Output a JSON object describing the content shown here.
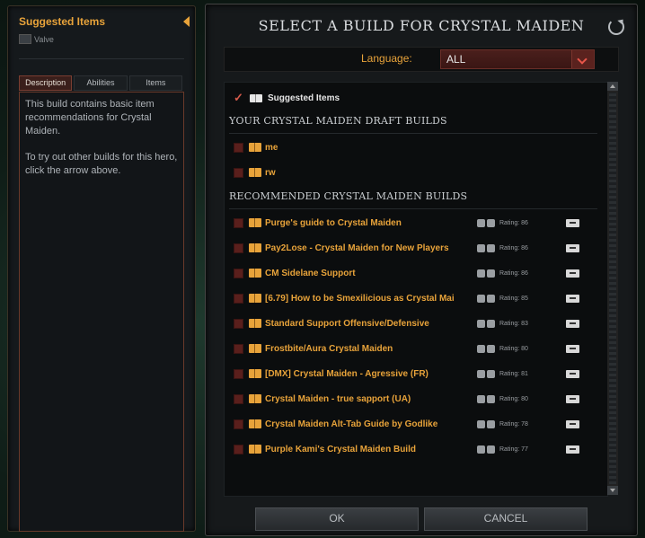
{
  "left_panel": {
    "title": "Suggested Items",
    "author": "Valve",
    "tabs": [
      "Description",
      "Abilities",
      "Items"
    ],
    "description": [
      "This build contains basic item recommendations for Crystal Maiden.",
      "To try out other builds for this hero, click the arrow above."
    ]
  },
  "dialog": {
    "title": "SELECT A BUILD FOR CRYSTAL MAIDEN",
    "language_label": "Language:",
    "language_value": "ALL",
    "suggested_label": "Suggested Items",
    "draft_header": "YOUR CRYSTAL MAIDEN DRAFT BUILDS",
    "draft_builds": [
      "me",
      "rw"
    ],
    "recommended_header": "RECOMMENDED CRYSTAL MAIDEN BUILDS",
    "recommended_builds": [
      {
        "name": "Purge's guide to Crystal Maiden",
        "rating": "Rating: 86"
      },
      {
        "name": "Pay2Lose - Crystal Maiden for New Players",
        "rating": "Rating: 86"
      },
      {
        "name": "CM Sidelane Support",
        "rating": "Rating: 86"
      },
      {
        "name": "[6.79] How to be Smexilicious as Crystal Mai",
        "rating": "Rating: 85"
      },
      {
        "name": "Standard Support Offensive/Defensive",
        "rating": "Rating: 83"
      },
      {
        "name": "Frostbite/Aura Crystal Maiden",
        "rating": "Rating: 80"
      },
      {
        "name": "[DMX] Crystal Maiden - Agressive (FR)",
        "rating": "Rating: 81"
      },
      {
        "name": "Crystal Maiden - true sapport (UA)",
        "rating": "Rating: 80"
      },
      {
        "name": "Crystal Maiden Alt-Tab Guide by Godlike",
        "rating": "Rating: 78"
      },
      {
        "name": "Purple Kami's Crystal Maiden Build",
        "rating": "Rating: 77"
      }
    ],
    "ok_label": "OK",
    "cancel_label": "CANCEL"
  },
  "colors": {
    "accent": "#e8a33a",
    "tab_active": "#3a1f1b",
    "checkbox": "#5a1f1c"
  }
}
